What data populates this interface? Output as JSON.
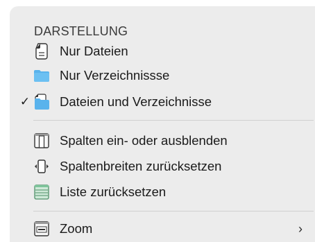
{
  "menu": {
    "section_header": "DARSTELLUNG",
    "items": [
      {
        "label": "Nur Dateien",
        "icon": "document-icon",
        "checked": false
      },
      {
        "label": "Nur Verzeichnissse",
        "icon": "folder-icon",
        "checked": false
      },
      {
        "label": "Dateien und Verzeichnisse",
        "icon": "files-and-folders-icon",
        "checked": true,
        "check_glyph": "✓"
      },
      {
        "label": "Spalten ein- oder ausblenden",
        "icon": "columns-icon",
        "checked": false
      },
      {
        "label": "Spaltenbreiten zurücksetzen",
        "icon": "column-width-icon",
        "checked": false
      },
      {
        "label": "Liste zurücksetzen",
        "icon": "list-icon",
        "checked": false
      },
      {
        "label": "Zoom",
        "icon": "zoom-icon",
        "checked": false,
        "submenu_glyph": "›"
      }
    ]
  },
  "colors": {
    "menu_background": "#ececec",
    "folder_blue": "#5ab3ec",
    "list_green": "#7dc49a"
  }
}
